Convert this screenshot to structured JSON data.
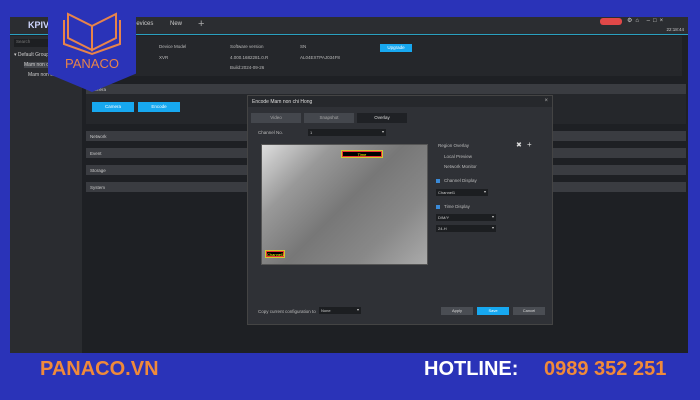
{
  "header": {
    "brand": "KPIVI",
    "tabs": [
      "Devices",
      "New"
    ],
    "clock": "22:18:44"
  },
  "sidebar": {
    "search_placeholder": "Search",
    "tree": [
      "Default Group",
      "Mam non chi Hong",
      "Mam non chi Hong"
    ]
  },
  "info": {
    "device_model_label": "Device Model",
    "device_model": "XVR",
    "software_label": "Software version",
    "software": "4.000.1682281.0.R",
    "build": "Build:2024-09-26",
    "sn_label": "SN",
    "sn": "AL04EXTPAJ034F8",
    "upgrade": "Upgrade"
  },
  "sections": {
    "camera": "Camera",
    "camera_btn": "Camera",
    "encode_btn": "Encode",
    "network": "Network",
    "event": "Event",
    "storage": "Storage",
    "system": "System"
  },
  "dialog": {
    "title": "Encode Mam non chi Hong",
    "tabs": [
      "Video",
      "Snapshot",
      "Overlay"
    ],
    "channel_label": "Channel No.",
    "channel": "1",
    "osd_time": "Time",
    "osd_channel": "Channel1",
    "region_overlay": "Region Overlay",
    "local_preview": "Local Preview",
    "network_monitor": "Network Monitor",
    "channel_display": "Channel Display",
    "channel_name": "Channel1",
    "time_display": "Time Display",
    "date_format": "D/M/Y",
    "time_format": "24-H",
    "copy_label": "Copy current configuration to",
    "copy_value": "None",
    "apply": "Apply",
    "save": "Save",
    "cancel": "Cancel"
  },
  "banner": {
    "logo_text": "PANACO",
    "site": "PANACO.VN",
    "hotline_label": "HOTLINE:",
    "hotline": "0989 352 251"
  }
}
